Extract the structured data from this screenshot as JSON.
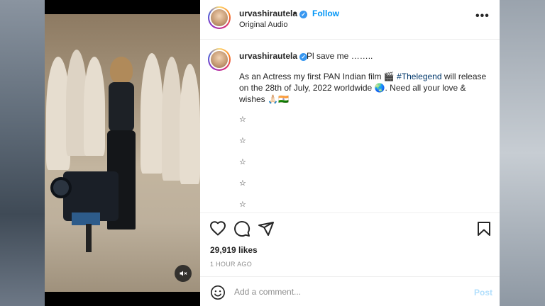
{
  "post": {
    "username": "urvashirautela",
    "follow_label": "Follow",
    "separator": "•",
    "audio": "Original Audio",
    "more_label": "•••"
  },
  "caption": {
    "username": "urvashirautela",
    "first_line": "Pl save me ……..",
    "body_part1": "As an Actress my first PAN Indian film 🎬 ",
    "hashtag": "#Thelegend",
    "body_part2": " will release on the 28th of July, 2022 worldwide 🌏. Need all your love & wishes 🙏🏻🇮🇳",
    "stars": [
      "☆",
      "☆",
      "☆",
      "☆",
      "☆"
    ]
  },
  "stats": {
    "likes": "29,919 likes",
    "time": "1 HOUR AGO"
  },
  "comment": {
    "placeholder": "Add a comment...",
    "post_label": "Post"
  },
  "icons": {
    "verified": "verified-badge-icon",
    "like": "heart-icon",
    "comment": "comment-bubble-icon",
    "share": "paper-plane-icon",
    "save": "bookmark-icon",
    "emoji": "smiley-icon",
    "mute": "speaker-muted-icon"
  },
  "colors": {
    "link_blue": "#0095f6",
    "hashtag": "#00376b",
    "verified": "#3897f0",
    "post_disabled": "#b2dffc"
  }
}
